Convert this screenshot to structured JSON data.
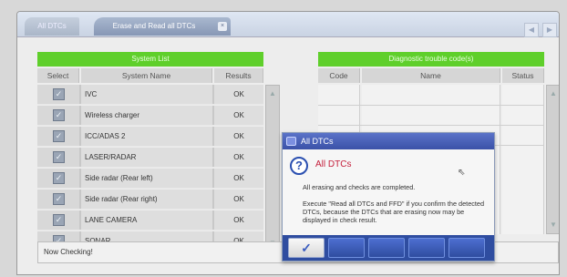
{
  "tabs": [
    {
      "label": "All DTCs",
      "active": false
    },
    {
      "label": "Erase and Read all DTCs",
      "active": true,
      "close": "×"
    }
  ],
  "nav": {
    "prev": "◀",
    "next": "▶"
  },
  "system_list": {
    "title": "System List",
    "columns": [
      "Select",
      "System Name",
      "Results"
    ],
    "rows": [
      {
        "checked": true,
        "name": "IVC",
        "result": "OK"
      },
      {
        "checked": true,
        "name": "Wireless charger",
        "result": "OK"
      },
      {
        "checked": true,
        "name": "ICC/ADAS 2",
        "result": "OK"
      },
      {
        "checked": true,
        "name": "LASER/RADAR",
        "result": "OK"
      },
      {
        "checked": true,
        "name": "Side radar (Rear left)",
        "result": "OK"
      },
      {
        "checked": true,
        "name": "Side radar (Rear right)",
        "result": "OK"
      },
      {
        "checked": true,
        "name": "LANE CAMERA",
        "result": "OK"
      },
      {
        "checked": true,
        "name": "SONAR",
        "result": "OK"
      }
    ],
    "check_glyph": "✓",
    "scroll_up": "▲",
    "scroll_down": "▼"
  },
  "dtc_panel": {
    "title": "Diagnostic trouble code(s)",
    "columns": [
      "Code",
      "Name",
      "Status"
    ]
  },
  "status_bar": {
    "text": "Now Checking!"
  },
  "dialog": {
    "title": "All DTCs",
    "heading": "All DTCs",
    "message1": "All erasing and checks are completed.",
    "message2": "Execute \"Read all DTCs and FFD\" if you confirm the detected DTCs, because the DTCs that are erasing now may be displayed in check result.",
    "ok_glyph": "✓",
    "question_glyph": "?"
  },
  "colors": {
    "header_green": "#5fcf2b",
    "dialog_title": "#3b52a8",
    "heading_red": "#c41e3a"
  }
}
